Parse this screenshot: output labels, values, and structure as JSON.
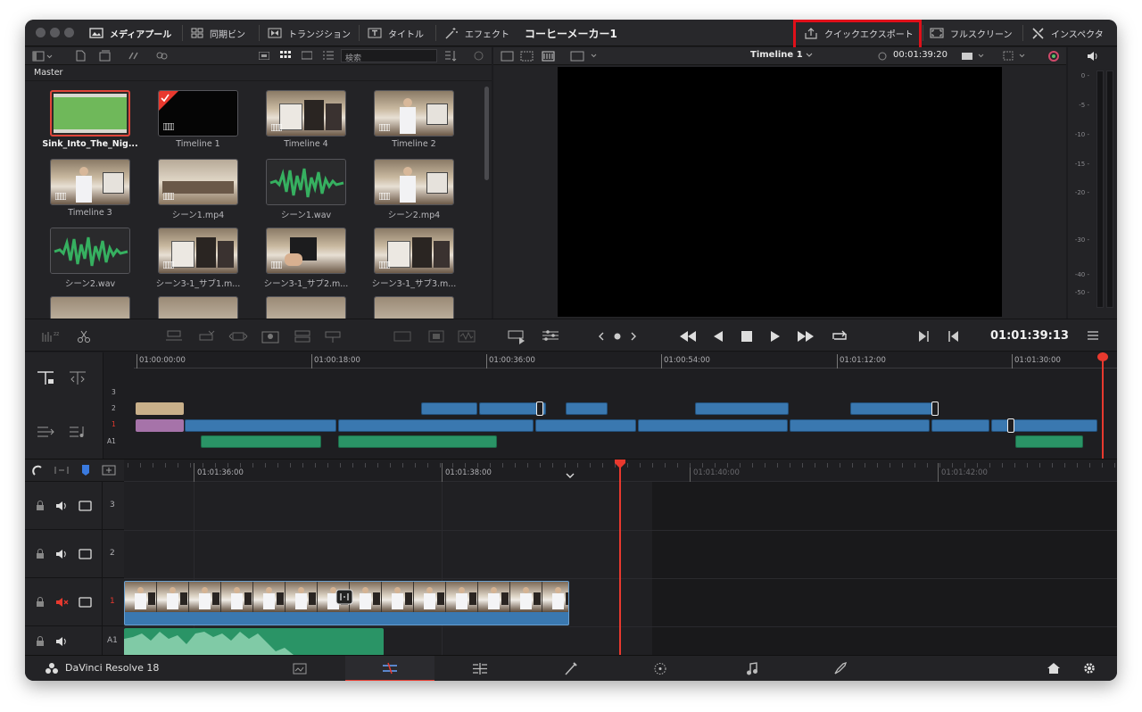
{
  "titlebar": {
    "media_pool": "メディアプール",
    "sync_bin": "同期ビン",
    "transition": "トランジション",
    "title": "タイトル",
    "effect": "エフェクト",
    "project_name": "コーヒーメーカー1",
    "quick_export": "クイックエクスポート",
    "fullscreen": "フルスクリーン",
    "inspector": "インスペクタ"
  },
  "media_pool": {
    "bin_name": "Master",
    "search_placeholder": "検索",
    "items": [
      {
        "label": "Sink_Into_The_Nig...",
        "kind": "audio-green",
        "selected": true
      },
      {
        "label": "Timeline 1",
        "kind": "timeline-black"
      },
      {
        "label": "Timeline 4",
        "kind": "video"
      },
      {
        "label": "Timeline 2",
        "kind": "video-person"
      },
      {
        "label": "Timeline 3",
        "kind": "video-person"
      },
      {
        "label": "シーン1.mp4",
        "kind": "video-room"
      },
      {
        "label": "シーン1.wav",
        "kind": "wave"
      },
      {
        "label": "シーン2.mp4",
        "kind": "video-person"
      },
      {
        "label": "シーン2.wav",
        "kind": "wave"
      },
      {
        "label": "シーン3-1_サブ1.m...",
        "kind": "video"
      },
      {
        "label": "シーン3-1_サブ2.m...",
        "kind": "video-hand"
      },
      {
        "label": "シーン3-1_サブ3.m...",
        "kind": "video"
      }
    ]
  },
  "viewer": {
    "timeline_name": "Timeline 1",
    "duration_tc": "00:01:39:20",
    "current_tc": "01:01:39:13"
  },
  "audio_meter": {
    "scale": [
      "0",
      "-5",
      "-10",
      "-15",
      "-20",
      "-30",
      "-40",
      "-50"
    ]
  },
  "upper_timeline": {
    "ruler": [
      "01:00:00:00",
      "01:00:18:00",
      "01:00:36:00",
      "01:00:54:00",
      "01:01:12:00",
      "01:01:30:00"
    ],
    "tracks": [
      "3",
      "2",
      "1",
      "A1"
    ]
  },
  "lower_timeline": {
    "ruler": [
      "01:01:36:00",
      "01:01:38:00",
      "01:01:40:00",
      "01:01:42:00"
    ],
    "tracks": [
      "3",
      "2",
      "1",
      "A1"
    ]
  },
  "footer": {
    "app_name": "DaVinci Resolve 18"
  },
  "colors": {
    "accent_red": "#e0101a",
    "clip_blue": "#3a78b0",
    "clip_green": "#2a9466",
    "playhead": "#e8392e"
  }
}
